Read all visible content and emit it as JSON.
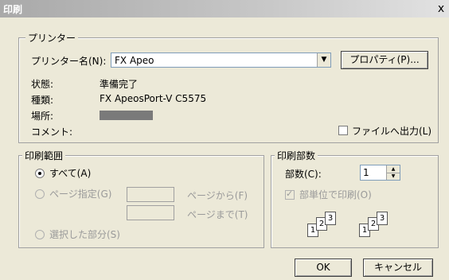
{
  "window": {
    "title": "印刷",
    "close_glyph": "x"
  },
  "printer": {
    "group_label": "プリンター",
    "name_label": "プリンター名(N):",
    "name_value": "FX Apeo",
    "dropdown_glyph": "▼",
    "properties_button": "プロパティ(P)...",
    "status_label": "状態:",
    "status_value": "準備完了",
    "type_label": "種類:",
    "type_value": "FX ApeosPort-V C5575",
    "location_label": "場所:",
    "comment_label": "コメント:",
    "print_to_file_label": "ファイルへ出力(L)"
  },
  "print_range": {
    "group_label": "印刷範囲",
    "all_label": "すべて(A)",
    "pages_label": "ページ指定(G)",
    "from_label": "ページから(F)",
    "to_label": "ページまで(T)",
    "selection_label": "選択した部分(S)",
    "selected": "all"
  },
  "copies": {
    "group_label": "印刷部数",
    "count_label": "部数(C):",
    "count_value": "1",
    "spin_up_glyph": "▲",
    "spin_down_glyph": "▼",
    "collate_label": "部単位で印刷(O)",
    "check_glyph": "✓",
    "collate_icon_numbers": [
      "1",
      "2",
      "3"
    ]
  },
  "buttons": {
    "ok": "OK",
    "cancel": "キャンセル"
  }
}
